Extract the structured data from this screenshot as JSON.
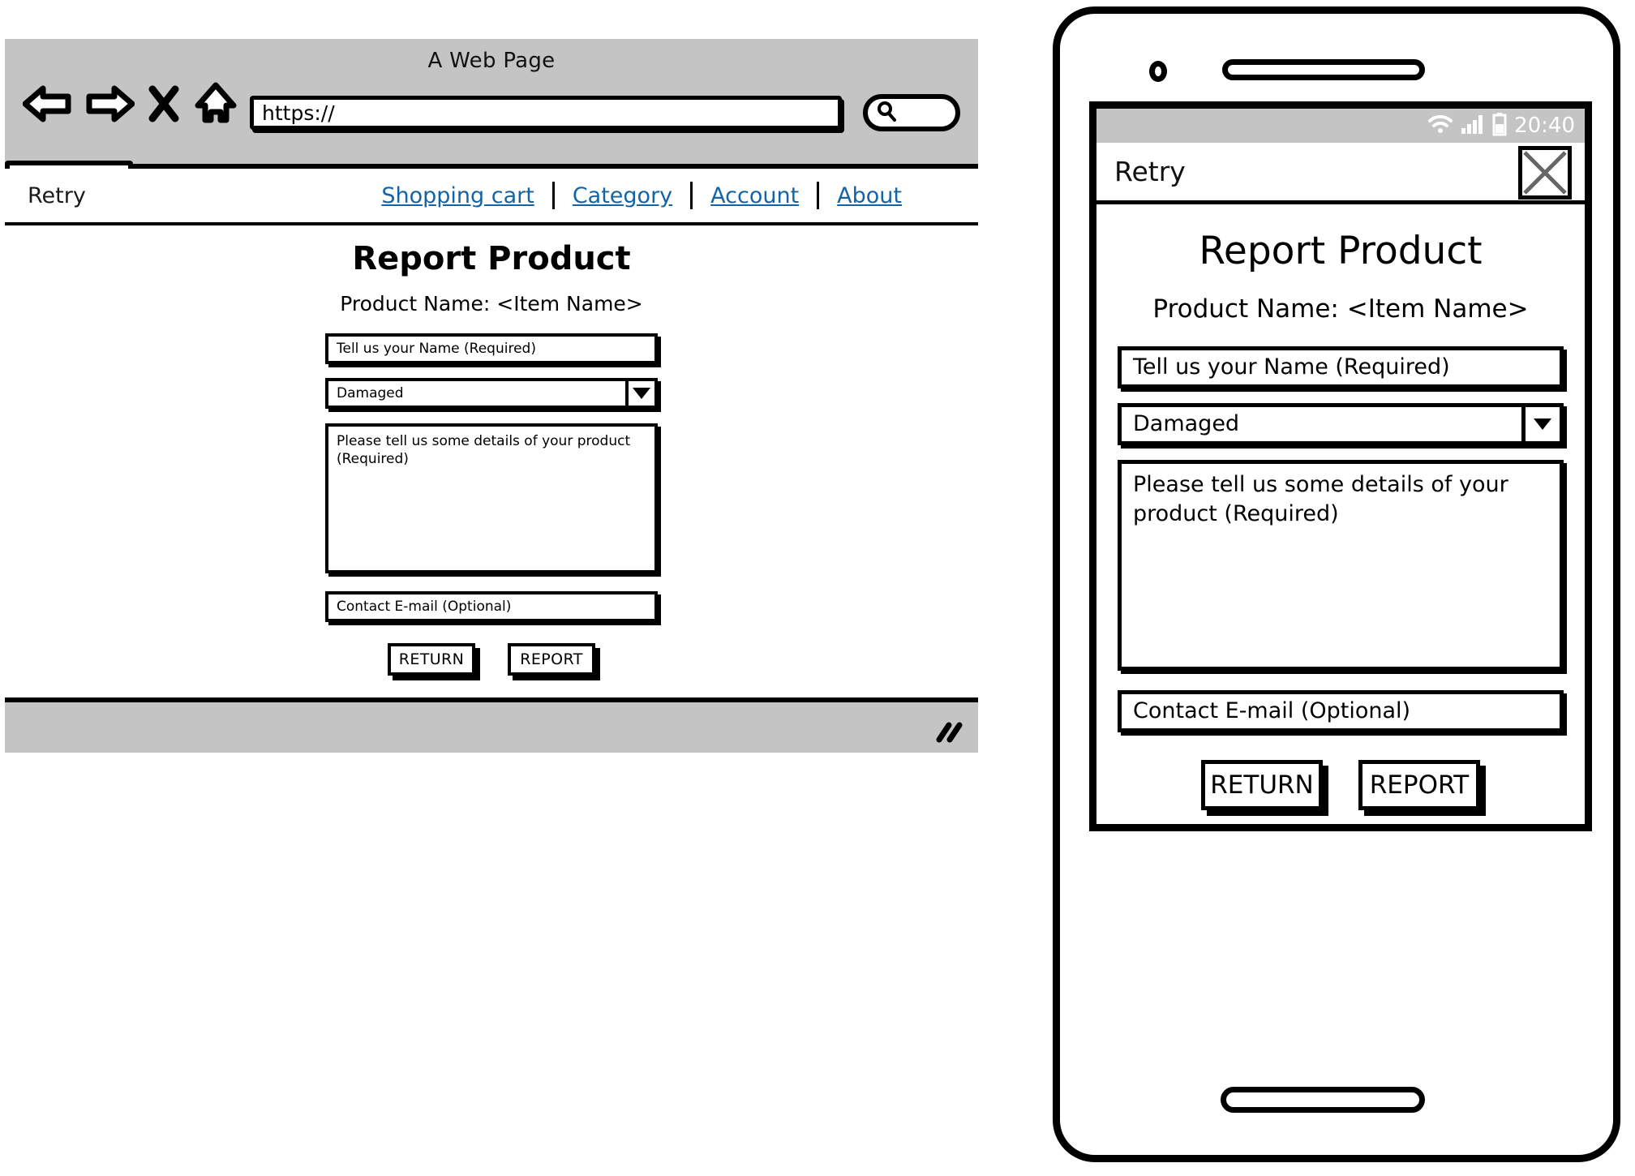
{
  "browser": {
    "window_title": "A Web Page",
    "url_value": "https://",
    "toolbar_icons": [
      "back-arrow-icon",
      "forward-arrow-icon",
      "close-x-icon",
      "home-icon",
      "search-icon"
    ],
    "search_placeholder": "",
    "tab_label": ""
  },
  "site_nav": {
    "brand": "Retry",
    "links": [
      "Shopping cart",
      "Category",
      "Account",
      "About"
    ]
  },
  "form": {
    "heading": "Report Product",
    "subheading": "Product Name: <Item Name>",
    "name_placeholder": "Tell us your Name (Required)",
    "reason_selected": "Damaged",
    "reason_options": [
      "Damaged"
    ],
    "details_placeholder": "Please tell us some details of your product (Required)",
    "email_placeholder": "Contact E-mail (Optional)",
    "return_label": "RETURN",
    "report_label": "REPORT"
  },
  "phone": {
    "status": {
      "clock": "20:40",
      "icons": [
        "wifi-icon",
        "signal-icon",
        "battery-icon"
      ]
    },
    "appbar": {
      "brand": "Retry",
      "menu_icon": "close-x-icon"
    }
  },
  "colors": {
    "chrome_gray": "#c4c4c4",
    "link_blue": "#1464a5",
    "ink": "#000000",
    "paper": "#ffffff"
  }
}
